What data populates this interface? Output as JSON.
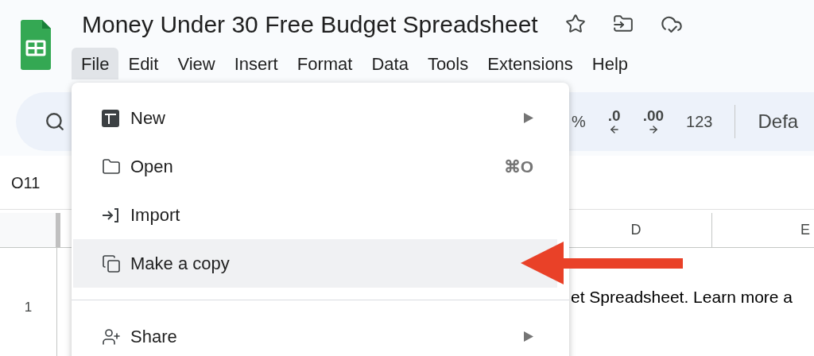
{
  "document": {
    "title": "Money Under 30 Free Budget Spreadsheet"
  },
  "menu_bar": [
    {
      "label": "File",
      "selected": true
    },
    {
      "label": "Edit",
      "selected": false
    },
    {
      "label": "View",
      "selected": false
    },
    {
      "label": "Insert",
      "selected": false
    },
    {
      "label": "Format",
      "selected": false
    },
    {
      "label": "Data",
      "selected": false
    },
    {
      "label": "Tools",
      "selected": false
    },
    {
      "label": "Extensions",
      "selected": false
    },
    {
      "label": "Help",
      "selected": false
    }
  ],
  "toolbar": {
    "items": [
      {
        "kind": "text",
        "label": "%"
      },
      {
        "kind": "decimal_decrease",
        "label": ".0"
      },
      {
        "kind": "decimal_increase",
        "label": ".00"
      },
      {
        "kind": "text",
        "label": "123"
      },
      {
        "kind": "divider"
      },
      {
        "kind": "font",
        "label": "Defa"
      }
    ]
  },
  "name_box": "O11",
  "grid": {
    "columns": [
      {
        "label": "D"
      },
      {
        "label": "E"
      }
    ],
    "rows": [
      {
        "label": "1",
        "cell_text": "et Spreadsheet. Learn more a"
      }
    ]
  },
  "file_menu": {
    "items": [
      {
        "kind": "item",
        "label": "New",
        "submenu": true,
        "selected": false
      },
      {
        "kind": "item",
        "label": "Open",
        "shortcut": "⌘O",
        "submenu": false,
        "selected": false
      },
      {
        "kind": "item",
        "label": "Import",
        "submenu": false,
        "selected": false
      },
      {
        "kind": "item",
        "label": "Make a copy",
        "submenu": false,
        "selected": true
      },
      {
        "kind": "divider"
      },
      {
        "kind": "item",
        "label": "Share",
        "submenu": true,
        "selected": false
      }
    ]
  }
}
